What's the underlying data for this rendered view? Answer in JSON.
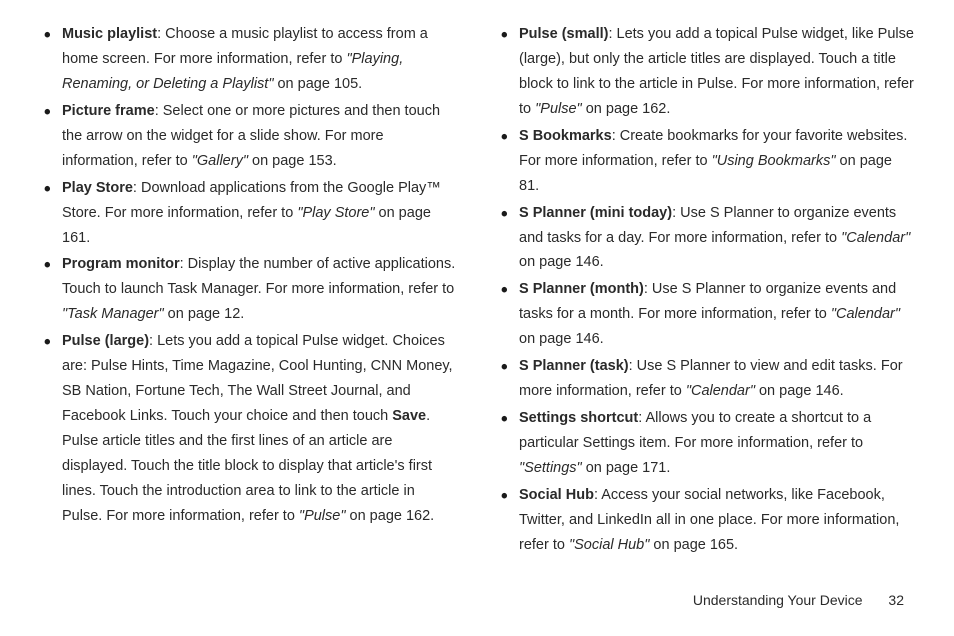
{
  "left": {
    "items": [
      {
        "title": "Music playlist",
        "body1": ": Choose a music playlist to access from a home screen. For more information, refer to ",
        "ref": "\"Playing, Renaming, or Deleting a Playlist\"",
        "body2": "  on page 105."
      },
      {
        "title": "Picture frame",
        "body1": ": Select one or more pictures and then touch the arrow on the widget for a slide show. For more information, refer to ",
        "ref": "\"Gallery\"",
        "body2": "  on page 153."
      },
      {
        "title": "Play Store",
        "body1": ": Download applications from the Google Play™ Store. For more information, refer to ",
        "ref": "\"Play Store\"",
        "body2": "  on page 161."
      },
      {
        "title": "Program monitor",
        "body1": ": Display the number of active applications. Touch to launch Task Manager. For more information, refer to ",
        "ref": "\"Task Manager\"",
        "body2": "  on page 12."
      },
      {
        "title": "Pulse (large)",
        "body1": ": Lets you add a topical Pulse widget. Choices are: Pulse Hints, Time Magazine, Cool Hunting, CNN Money, SB Nation, Fortune Tech, The Wall Street Journal, and Facebook Links. Touch your choice and then touch ",
        "boldword": "Save",
        "body1b": ". Pulse article titles and the first lines of an article are displayed. Touch the title block to display that article's first lines. Touch the introduction area to link to the article in Pulse. For more information, refer to ",
        "ref": "\"Pulse\"",
        "body2": "  on page 162."
      }
    ]
  },
  "right": {
    "items": [
      {
        "title": "Pulse (small)",
        "body1": ": Lets you add a topical Pulse widget, like Pulse (large), but only the article titles are displayed. Touch a title block to link to the article in Pulse. For more information, refer to ",
        "ref": "\"Pulse\"",
        "body2": "  on page 162."
      },
      {
        "title": "S Bookmarks",
        "body1": ": Create bookmarks for your favorite websites. For more information, refer to ",
        "ref": "\"Using Bookmarks\"",
        "body2": "  on page 81."
      },
      {
        "title": "S Planner (mini today)",
        "body1": ": Use S Planner to organize events and tasks for a day. For more information, refer to ",
        "ref": "\"Calendar\"",
        "body2": "  on page 146."
      },
      {
        "title": "S Planner (month)",
        "body1": ": Use S Planner to organize events and tasks for a month. For more information, refer to ",
        "ref": "\"Calendar\"",
        "body2": "  on page 146."
      },
      {
        "title": "S Planner (task)",
        "body1": ": Use S Planner to view and edit tasks. For more information, refer to ",
        "ref": "\"Calendar\"",
        "body2": "  on page 146."
      },
      {
        "title": "Settings shortcut",
        "body1": ": Allows you to create a shortcut to a particular Settings item. For more information, refer to ",
        "ref": "\"Settings\"",
        "body2": "  on page 171."
      },
      {
        "title": "Social Hub",
        "body1": ": Access your social networks, like Facebook, Twitter, and LinkedIn all in one place. For more information, refer to ",
        "ref": "\"Social Hub\"",
        "body2": "  on page 165."
      }
    ]
  },
  "footer": {
    "section": "Understanding Your Device",
    "page": "32"
  }
}
